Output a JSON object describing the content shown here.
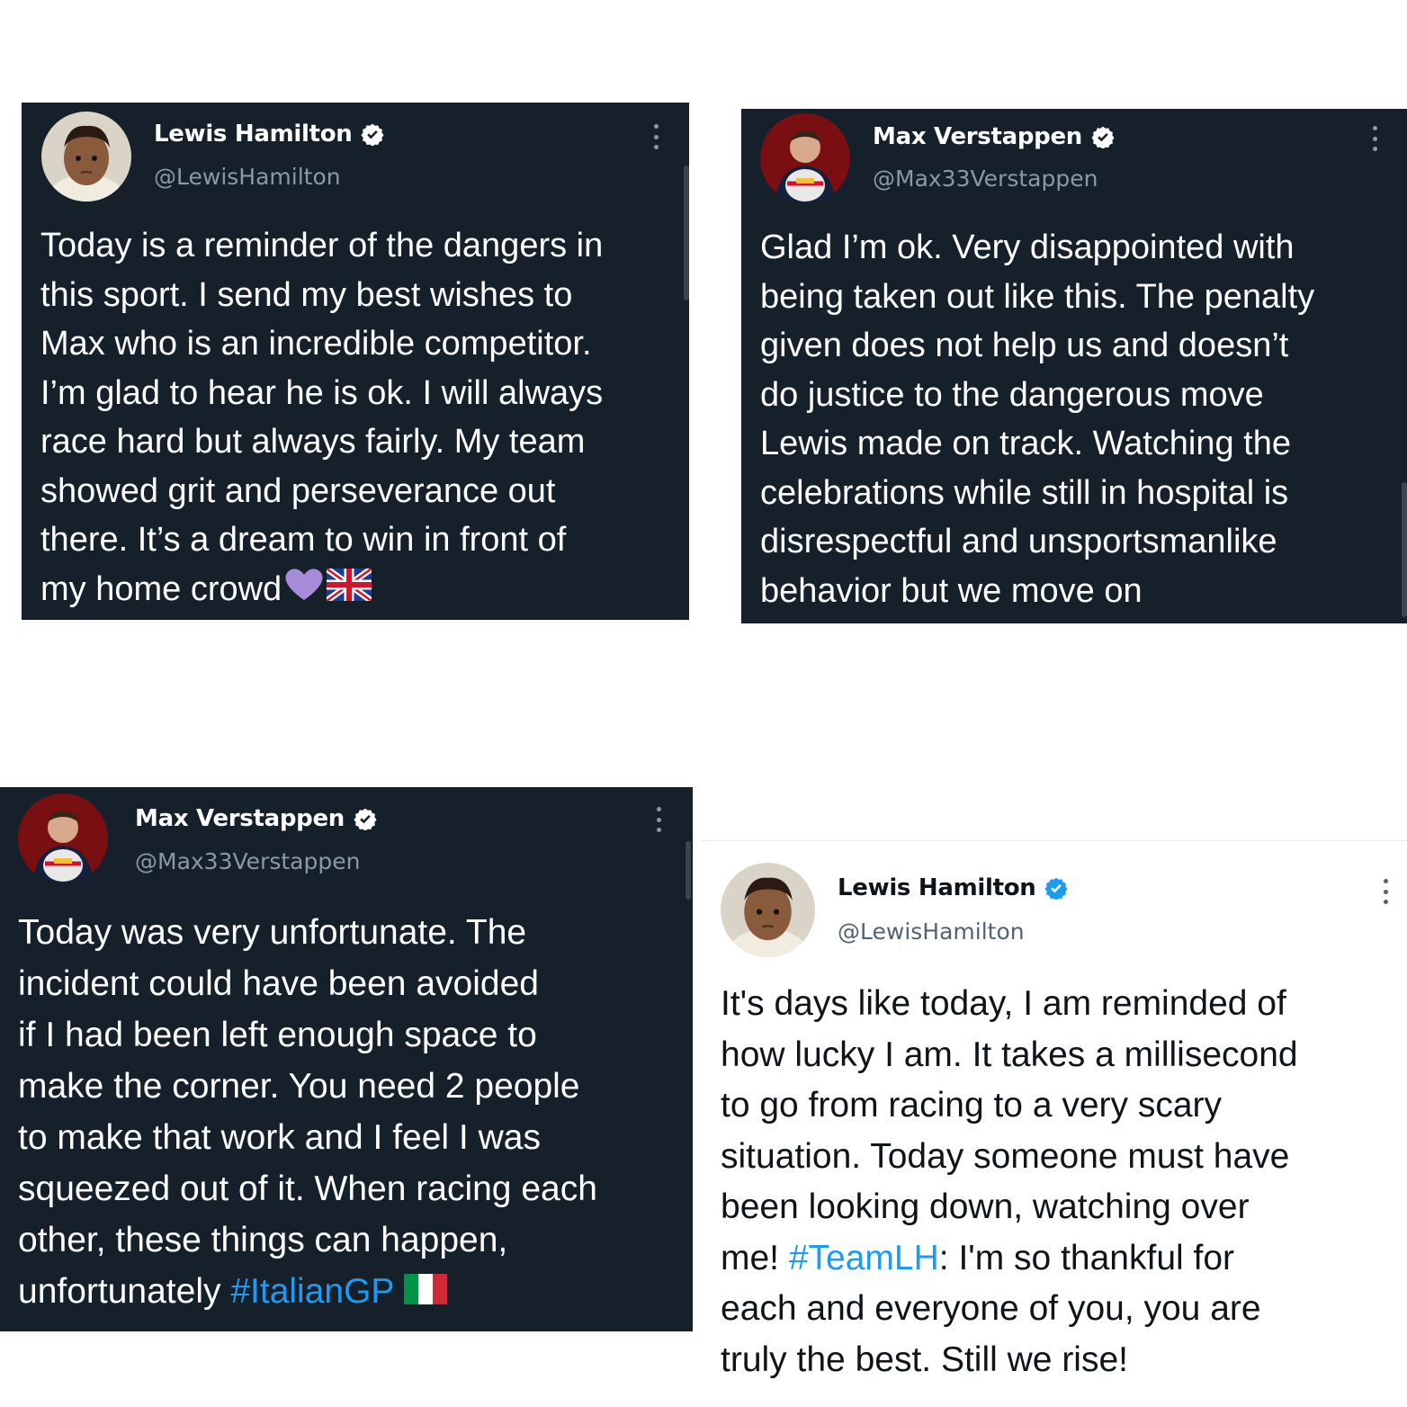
{
  "tweets": [
    {
      "name": "Lewis Hamilton",
      "handle": "@LewisHamilton",
      "text": "Today is a reminder of the dangers in\nthis sport. I send my best wishes to\nMax who is an incredible competitor.\nI’m glad to hear he is ok. I will always\nrace hard but always fairly. My team\nshowed grit and perseverance out\nthere. It’s a dream to win in front of\nmy home crowd",
      "emoji": [
        "purple-heart-icon",
        "uk-flag-icon"
      ],
      "theme": "dark"
    },
    {
      "name": "Max Verstappen",
      "handle": "@Max33Verstappen",
      "text": "Glad I’m ok. Very disappointed with\nbeing taken out like this. The penalty\ngiven does not help us and doesn’t\ndo justice to the dangerous move\nLewis made on track. Watching the\ncelebrations while still in hospital is\ndisrespectful and unsportsmanlike\nbehavior but we move on",
      "theme": "dark"
    },
    {
      "name": "Max Verstappen",
      "handle": "@Max33Verstappen",
      "text": "Today was very unfortunate. The\nincident could have been avoided\nif I had been left enough space to\nmake the corner. You need 2 people\nto make that work and I feel I was\nsqueezed out of it. When racing each\nother, these things can happen,\nunfortunately ",
      "hashtag": "#ItalianGP",
      "emoji": [
        "italy-flag-icon"
      ],
      "theme": "dark"
    },
    {
      "name": "Lewis Hamilton",
      "handle": "@LewisHamilton",
      "text_before": "It's days like today, I am reminded of\nhow lucky I am. It takes a millisecond\nto go from racing to a very scary\nsituation. Today someone must have\nbeen looking down, watching over\nme! ",
      "hashtag": "#TeamLH",
      "text_after": ": I'm so thankful for\neach and everyone of you, you are\ntruly the best. Still we rise!",
      "theme": "light"
    }
  ],
  "colors": {
    "dark_bg": "#15202b",
    "hashtag": "#1d9bf0",
    "verified_light": "#1d9bf0",
    "verified_dark": "#ffffff"
  }
}
